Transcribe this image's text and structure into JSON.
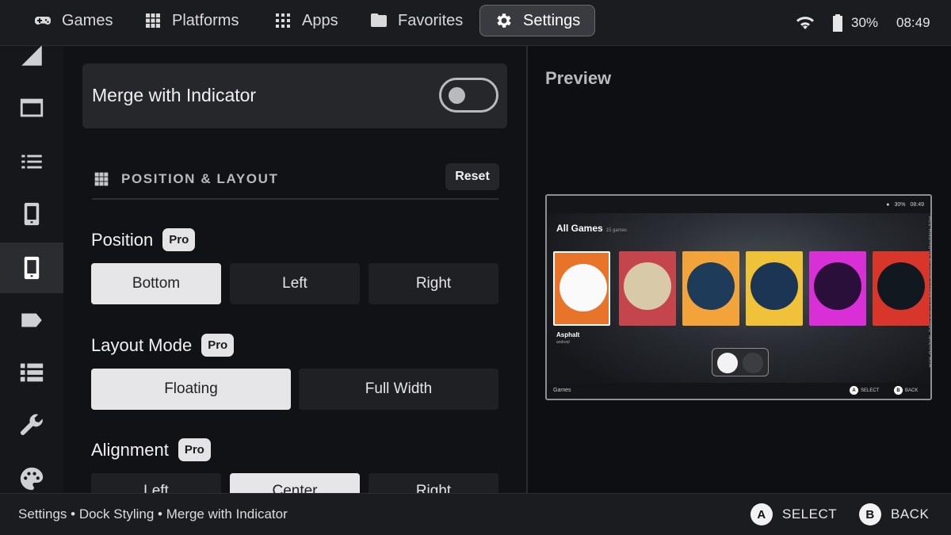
{
  "top_tabs": [
    {
      "label": "Games",
      "icon": "gamepad-icon"
    },
    {
      "label": "Platforms",
      "icon": "grid-icon"
    },
    {
      "label": "Apps",
      "icon": "apps-icon"
    },
    {
      "label": "Favorites",
      "icon": "folder-icon"
    },
    {
      "label": "Settings",
      "icon": "gear-icon",
      "active": true
    }
  ],
  "status": {
    "battery": "30%",
    "time": "08:49"
  },
  "rail_icons": [
    "signal-icon",
    "window-icon",
    "list-icon",
    "phone-icon",
    "phone-active-icon",
    "tag-icon",
    "table-icon",
    "wrench-icon",
    "palette-icon"
  ],
  "settings": {
    "merge_label": "Merge with Indicator",
    "merge_enabled": false,
    "section_title": "POSITION & LAYOUT",
    "reset_label": "Reset",
    "position": {
      "label": "Position",
      "badge": "Pro",
      "options": [
        "Bottom",
        "Left",
        "Right"
      ],
      "selected": "Bottom"
    },
    "layout_mode": {
      "label": "Layout Mode",
      "badge": "Pro",
      "options": [
        "Floating",
        "Full Width"
      ],
      "selected": "Floating"
    },
    "alignment": {
      "label": "Alignment",
      "badge": "Pro",
      "options": [
        "Left",
        "Center",
        "Right"
      ],
      "selected": "Center"
    }
  },
  "preview": {
    "title": "Preview",
    "mini_status": {
      "battery": "30%",
      "time": "08:49"
    },
    "heading": "All Games",
    "count": "15 games",
    "side_labels": "ALL   ANDROID   ACORN COMPUTERS BBC MICRO   ATA",
    "focused_game": "Asphalt",
    "focused_sub": "android",
    "tile_colors": [
      "#e8742a",
      "#c4454c",
      "#f2a33a",
      "#f0c23a",
      "#d92fd6",
      "#d8362a"
    ],
    "footer_label": "Games",
    "footer_select": "SELECT",
    "footer_back": "BACK"
  },
  "bottom": {
    "breadcrumb": "Settings • Dock Styling • Merge with Indicator",
    "select_key": "A",
    "select_label": "SELECT",
    "back_key": "B",
    "back_label": "BACK"
  }
}
